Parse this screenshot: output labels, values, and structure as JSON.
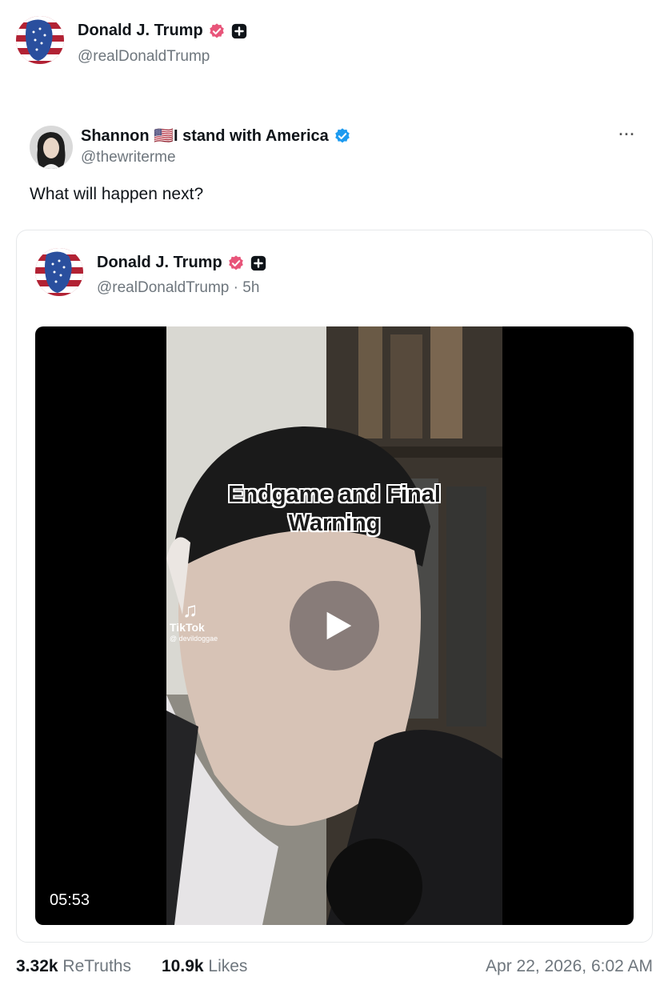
{
  "author": {
    "name": "Donald J. Trump",
    "handle": "@realDonaldTrump"
  },
  "retruth": {
    "name": "Shannon 🇺🇸I stand with America",
    "handle": "@thewriterme",
    "text": "What will happen next?",
    "more_label": "···"
  },
  "quoted": {
    "name": "Donald J. Trump",
    "handle_time": "@realDonaldTrump · 5h",
    "video": {
      "overlay_line1": "Endgame and Final",
      "overlay_line2": "Warning",
      "watermark_name": "TikTok",
      "watermark_user": "@ devildoggae",
      "duration": "05:53"
    }
  },
  "stats": {
    "retruths_count": "3.32k",
    "retruths_label": "ReTruths",
    "likes_count": "10.9k",
    "likes_label": "Likes",
    "timestamp": "Apr 22, 2026, 6:02 AM"
  },
  "colors": {
    "verified_pink": "#e8557a",
    "verified_blue": "#1d9bf0",
    "muted": "#6e767d"
  }
}
